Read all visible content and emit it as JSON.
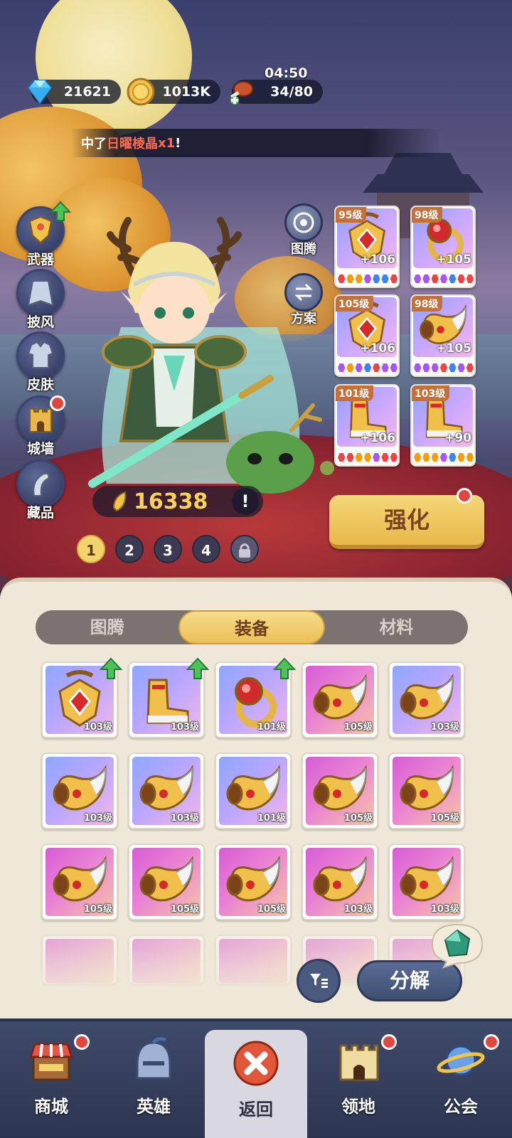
{
  "resources": {
    "diamonds": "21621",
    "gold": "1013K",
    "stamina": "34/80",
    "timer": "04:50"
  },
  "banner": {
    "prefix": "中了",
    "item": "日曜棱晶",
    "qty": "x1",
    "suffix": "!"
  },
  "side_menu": [
    {
      "label": "武器",
      "icon": "weapon-icon",
      "upgrade": true,
      "reddot": false
    },
    {
      "label": "披风",
      "icon": "cape-icon",
      "upgrade": false,
      "reddot": false
    },
    {
      "label": "皮肤",
      "icon": "skin-icon",
      "upgrade": false,
      "reddot": false
    },
    {
      "label": "城墙",
      "icon": "wall-icon",
      "upgrade": false,
      "reddot": true
    },
    {
      "label": "藏品",
      "icon": "collection-icon",
      "upgrade": false,
      "reddot": false
    }
  ],
  "mid_menu": {
    "totem": "图腾",
    "plan": "方案"
  },
  "equipped": [
    {
      "level": "95级",
      "plus": "+106"
    },
    {
      "level": "98级",
      "plus": "+105"
    },
    {
      "level": "105级",
      "plus": "+106"
    },
    {
      "level": "98级",
      "plus": "+105"
    },
    {
      "level": "101级",
      "plus": "+106"
    },
    {
      "level": "103级",
      "plus": "+90"
    }
  ],
  "power": "16338",
  "pages": [
    "1",
    "2",
    "3",
    "4"
  ],
  "strengthen_label": "强化",
  "tabs": [
    "图腾",
    "装备",
    "材料"
  ],
  "active_tab": "装备",
  "inventory": [
    {
      "level": "103级",
      "color": "purple",
      "up": true,
      "type": "amulet"
    },
    {
      "level": "103级",
      "color": "purple",
      "up": true,
      "type": "boots"
    },
    {
      "level": "101级",
      "color": "purple",
      "up": true,
      "type": "ring"
    },
    {
      "level": "105级",
      "color": "pink",
      "up": false,
      "type": "horn"
    },
    {
      "level": "103级",
      "color": "purple",
      "up": false,
      "type": "horn"
    },
    {
      "level": "103级",
      "color": "purple",
      "up": false,
      "type": "horn"
    },
    {
      "level": "103级",
      "color": "purple",
      "up": false,
      "type": "horn"
    },
    {
      "level": "101级",
      "color": "purple",
      "up": false,
      "type": "horn"
    },
    {
      "level": "105级",
      "color": "pink",
      "up": false,
      "type": "horn"
    },
    {
      "level": "105级",
      "color": "pink",
      "up": false,
      "type": "horn"
    },
    {
      "level": "105级",
      "color": "pink",
      "up": false,
      "type": "horn"
    },
    {
      "level": "105级",
      "color": "pink",
      "up": false,
      "type": "horn"
    },
    {
      "level": "105级",
      "color": "pink",
      "up": false,
      "type": "horn"
    },
    {
      "level": "103级",
      "color": "pink",
      "up": false,
      "type": "horn"
    },
    {
      "level": "103级",
      "color": "pink",
      "up": false,
      "type": "horn"
    }
  ],
  "decompose_label": "分解",
  "nav": [
    {
      "label": "商城",
      "icon": "shop-icon",
      "reddot": true
    },
    {
      "label": "英雄",
      "icon": "hero-helmet-icon",
      "reddot": false
    },
    {
      "label": "返回",
      "icon": "close-icon",
      "reddot": false
    },
    {
      "label": "领地",
      "icon": "castle-icon",
      "reddot": true
    },
    {
      "label": "公会",
      "icon": "planet-icon",
      "reddot": true
    }
  ]
}
